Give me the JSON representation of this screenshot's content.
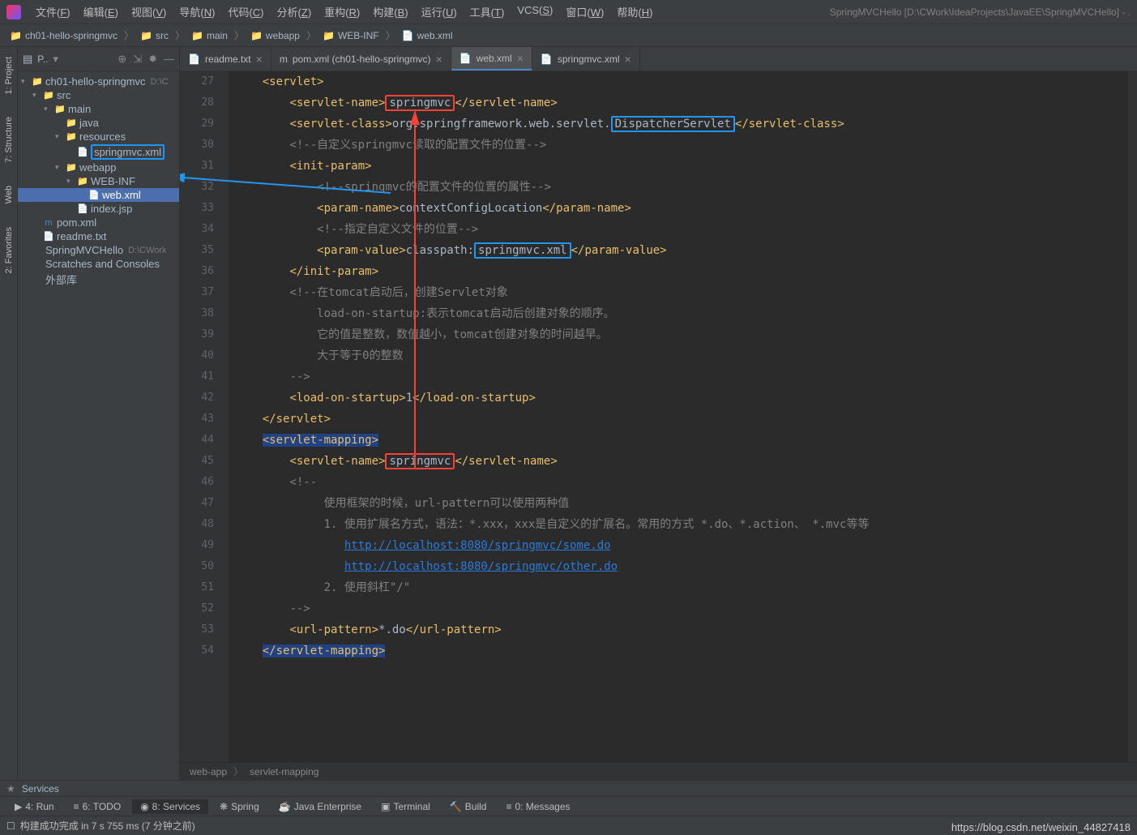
{
  "titlebar": {
    "menus": [
      "文件(F)",
      "编辑(E)",
      "视图(V)",
      "导航(N)",
      "代码(C)",
      "分析(Z)",
      "重构(R)",
      "构建(B)",
      "运行(U)",
      "工具(T)",
      "VCS(S)",
      "窗口(W)",
      "帮助(H)"
    ],
    "project_path": "SpringMVCHello [D:\\CWork\\IdeaProjects\\JavaEE\\SpringMVCHello] - ."
  },
  "breadcrumbs": [
    "ch01-hello-springmvc",
    "src",
    "main",
    "webapp",
    "WEB-INF",
    "web.xml"
  ],
  "left_tabs": [
    "1: Project",
    "7: Structure",
    "Web",
    "2: Favorites"
  ],
  "project_panel": {
    "title": "P..",
    "tree": [
      {
        "indent": 0,
        "arrow": "▾",
        "icon": "📁",
        "label": "ch01-hello-springmvc",
        "suffix": "D:\\C"
      },
      {
        "indent": 1,
        "arrow": "▾",
        "icon": "📁",
        "label": "src"
      },
      {
        "indent": 2,
        "arrow": "▾",
        "icon": "📁",
        "label": "main"
      },
      {
        "indent": 3,
        "arrow": "",
        "icon": "📁",
        "label": "java",
        "color": "#4a8af4"
      },
      {
        "indent": 3,
        "arrow": "▾",
        "icon": "📁",
        "label": "resources"
      },
      {
        "indent": 4,
        "arrow": "",
        "icon": "📄",
        "label": "springmvc.xml",
        "highlighted": true
      },
      {
        "indent": 3,
        "arrow": "▾",
        "icon": "📁",
        "label": "webapp",
        "boxed": true
      },
      {
        "indent": 4,
        "arrow": "▾",
        "icon": "📁",
        "label": "WEB-INF"
      },
      {
        "indent": 5,
        "arrow": "",
        "icon": "📄",
        "label": "web.xml",
        "selected": true
      },
      {
        "indent": 4,
        "arrow": "",
        "icon": "📄",
        "label": "index.jsp"
      },
      {
        "indent": 1,
        "arrow": "",
        "icon": "m",
        "label": "pom.xml",
        "iconcolor": "#4a88c7"
      },
      {
        "indent": 1,
        "arrow": "",
        "icon": "📄",
        "label": "readme.txt"
      },
      {
        "indent": 0,
        "arrow": "",
        "icon": "",
        "label": "SpringMVCHello",
        "suffix": "D:\\CWork"
      },
      {
        "indent": 0,
        "arrow": "",
        "icon": "",
        "label": "Scratches and Consoles"
      },
      {
        "indent": 0,
        "arrow": "",
        "icon": "",
        "label": "外部库"
      }
    ]
  },
  "editor_tabs": [
    {
      "icon": "📄",
      "label": "readme.txt",
      "close": true
    },
    {
      "icon": "m",
      "label": "pom.xml (ch01-hello-springmvc)",
      "close": true
    },
    {
      "icon": "📄",
      "label": "web.xml",
      "close": true,
      "active": true
    },
    {
      "icon": "📄",
      "label": "springmvc.xml",
      "close": true
    }
  ],
  "code_lines": [
    {
      "n": 27,
      "html": "    <span class='tag'>&lt;servlet&gt;</span>"
    },
    {
      "n": 28,
      "html": "        <span class='tag'>&lt;servlet-name&gt;</span><span class='red-box'>springmvc</span><span class='tag'>&lt;/servlet-name&gt;</span>"
    },
    {
      "n": 29,
      "html": "        <span class='tag'>&lt;servlet-class&gt;</span><span class='text-val'>org.springframework.web.servlet.</span><span class='blue-box'>DispatcherServlet</span><span class='tag'>&lt;/servlet-class&gt;</span>"
    },
    {
      "n": 30,
      "html": "        <span class='comment'>&lt;!--自定义springmvc读取的配置文件的位置--&gt;</span>"
    },
    {
      "n": 31,
      "html": "        <span class='tag'>&lt;init-param&gt;</span>"
    },
    {
      "n": 32,
      "html": "            <span class='comment'>&lt;!--springmvc的配置文件的位置的属性--&gt;</span>"
    },
    {
      "n": 33,
      "html": "            <span class='tag'>&lt;param-name&gt;</span><span class='text-val'>contextConfigLocation</span><span class='tag'>&lt;/param-name&gt;</span>"
    },
    {
      "n": 34,
      "html": "            <span class='comment'>&lt;!--指定自定义文件的位置--&gt;</span>"
    },
    {
      "n": 35,
      "html": "            <span class='tag'>&lt;param-value&gt;</span><span class='text-val'>classpath:</span><span class='blue-box'>springmvc.xml</span><span class='tag'>&lt;/param-value&gt;</span>"
    },
    {
      "n": 36,
      "html": "        <span class='tag'>&lt;/init-param&gt;</span>"
    },
    {
      "n": 37,
      "html": "        <span class='comment'>&lt;!--在tomcat启动后，创建Servlet对象</span>"
    },
    {
      "n": 38,
      "html": "            <span class='comment'>load-on-startup:表示tomcat启动后创建对象的顺序。</span>"
    },
    {
      "n": 39,
      "html": "            <span class='comment'>它的值是整数，数值越小，tomcat创建对象的时间越早。</span>"
    },
    {
      "n": 40,
      "html": "            <span class='comment'>大于等于0的整数</span>"
    },
    {
      "n": 41,
      "html": "        <span class='comment'>--&gt;</span>"
    },
    {
      "n": 42,
      "html": "        <span class='tag'>&lt;load-on-startup&gt;</span><span class='text-val'>1</span><span class='tag'>&lt;/load-on-startup&gt;</span>"
    },
    {
      "n": 43,
      "html": "    <span class='tag'>&lt;/servlet&gt;</span>"
    },
    {
      "n": 44,
      "html": "    <span class='tag hl-tag'>&lt;servlet-mapping&gt;</span>"
    },
    {
      "n": 45,
      "html": "        <span class='tag'>&lt;servlet-name&gt;</span><span class='red-box'>springmvc</span><span class='tag'>&lt;/servlet-name&gt;</span>"
    },
    {
      "n": 46,
      "html": "        <span class='comment'>&lt;!--</span>"
    },
    {
      "n": 47,
      "html": "             <span class='comment'>使用框架的时候，url-pattern可以使用两种值</span>"
    },
    {
      "n": 48,
      "html": "             <span class='comment'>1. 使用扩展名方式，语法：*.xxx，xxx是自定义的扩展名。常用的方式 *.do、*.action、 *.mvc等等</span>"
    },
    {
      "n": 49,
      "html": "                <span class='url-link'>http://localhost:8080/springmvc/some.do</span>"
    },
    {
      "n": 50,
      "html": "                <span class='url-link'>http://localhost:8080/springmvc/other.do</span>"
    },
    {
      "n": 51,
      "html": "             <span class='comment'>2. 使用斜杠\"/\"</span>"
    },
    {
      "n": 52,
      "html": "        <span class='comment'>--&gt;</span>"
    },
    {
      "n": 53,
      "html": "        <span class='tag'>&lt;url-pattern&gt;</span><span class='text-val'>*.do</span><span class='tag'>&lt;/url-pattern&gt;</span>"
    },
    {
      "n": 54,
      "html": "    <span class='tag hl-tag'>&lt;/servlet-mapping&gt;</span>"
    }
  ],
  "bottom_breadcrumb": [
    "web-app",
    "servlet-mapping"
  ],
  "services_label": "Services",
  "bottom_tabs": [
    {
      "icon": "▶",
      "label": "4: Run"
    },
    {
      "icon": "≡",
      "label": "6: TODO"
    },
    {
      "icon": "◉",
      "label": "8: Services",
      "active": true
    },
    {
      "icon": "❋",
      "label": "Spring"
    },
    {
      "icon": "☕",
      "label": "Java Enterprise"
    },
    {
      "icon": "▣",
      "label": "Terminal"
    },
    {
      "icon": "🔨",
      "label": "Build"
    },
    {
      "icon": "≡",
      "label": "0: Messages"
    }
  ],
  "statusbar": {
    "build_msg": "构建成功完成 in 7 s 755 ms (7 分钟之前)"
  },
  "watermark": "https://blog.csdn.net/weixin_44827418"
}
